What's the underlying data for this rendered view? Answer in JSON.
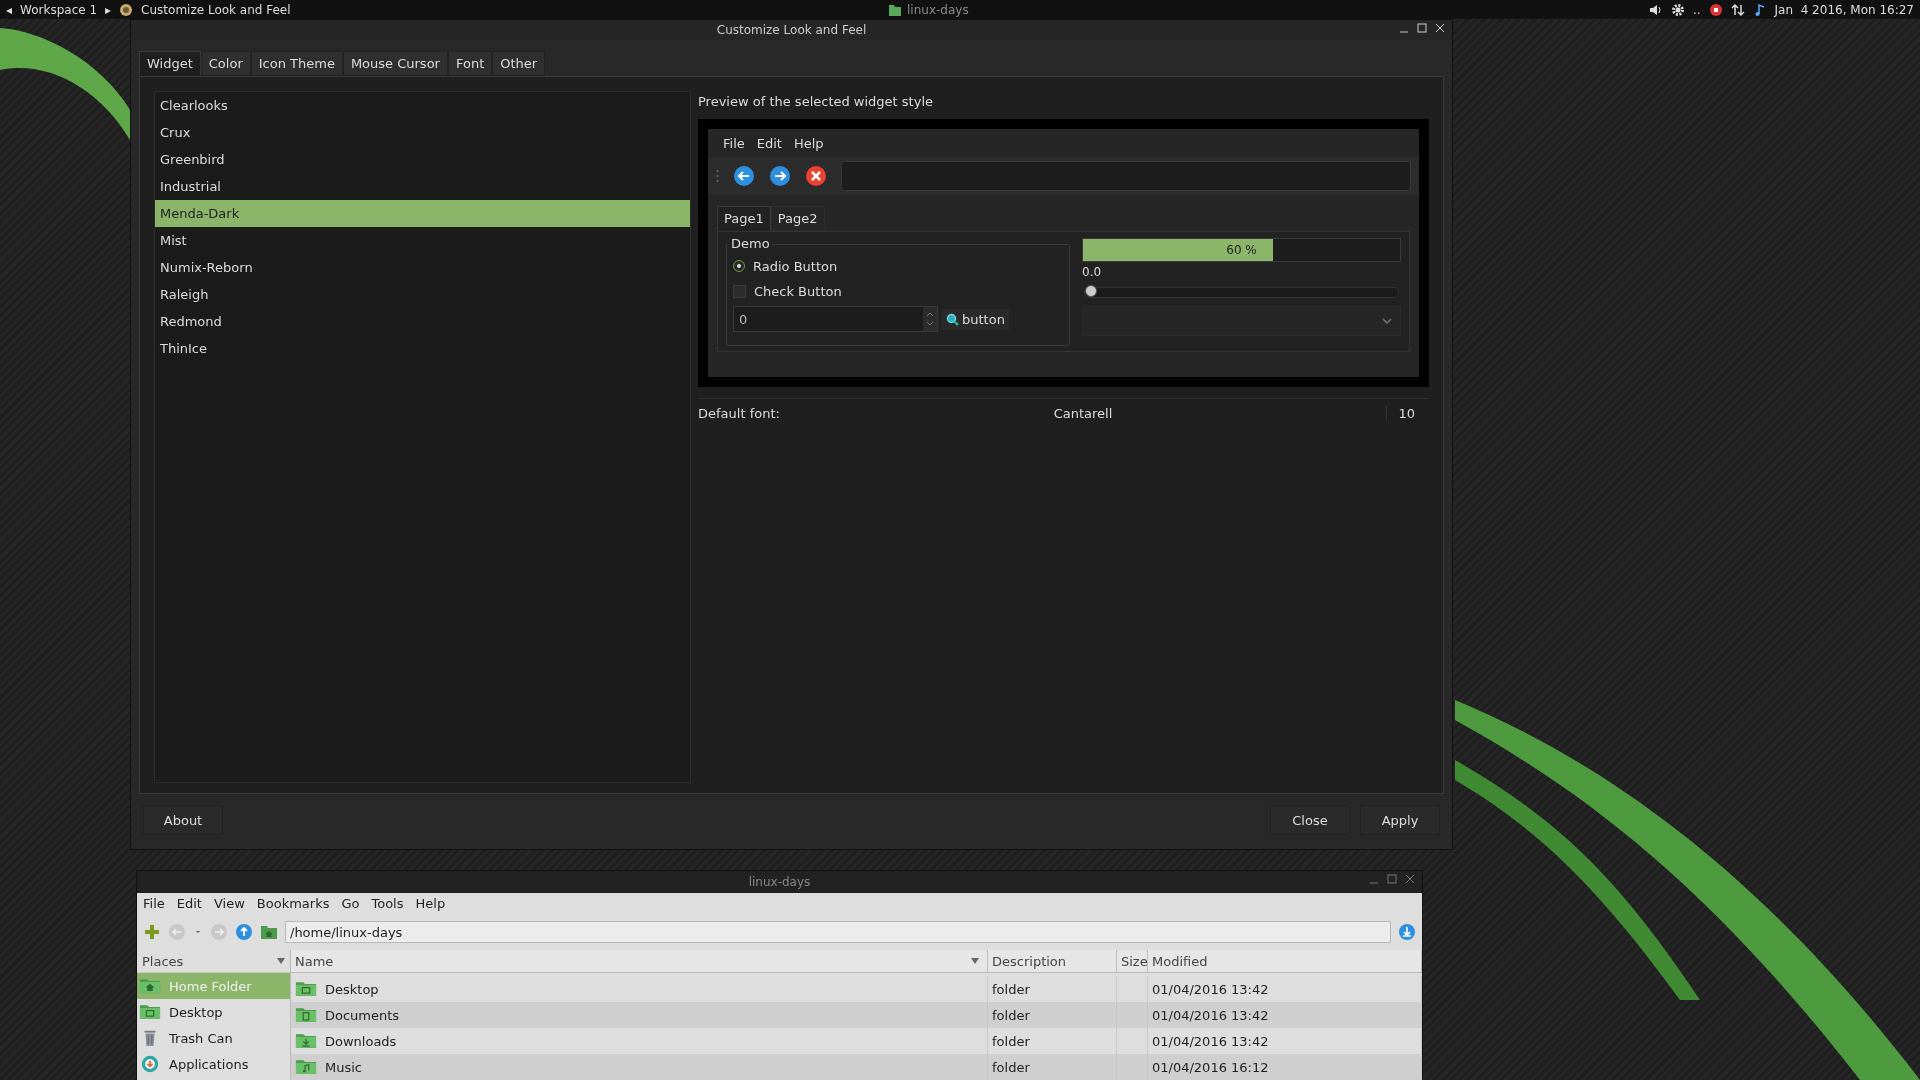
{
  "top_panel": {
    "prev_arrow": "◂",
    "workspace": "Workspace 1",
    "next_arrow": "▸",
    "active_window": "Customize Look and Feel",
    "task": "linux-days",
    "tray_dots": "..",
    "clock": "Jan  4 2016, Mon 16:27"
  },
  "dialog": {
    "title": "Customize Look and Feel",
    "tabs": [
      {
        "label": "Widget",
        "selected": true
      },
      {
        "label": "Color",
        "selected": false
      },
      {
        "label": "Icon Theme",
        "selected": false
      },
      {
        "label": "Mouse Cursor",
        "selected": false
      },
      {
        "label": "Font",
        "selected": false
      },
      {
        "label": "Other",
        "selected": false
      }
    ],
    "themes": [
      {
        "name": "Clearlooks",
        "selected": false
      },
      {
        "name": "Crux",
        "selected": false
      },
      {
        "name": "Greenbird",
        "selected": false
      },
      {
        "name": "Industrial",
        "selected": false
      },
      {
        "name": "Menda-Dark",
        "selected": true
      },
      {
        "name": "Mist",
        "selected": false
      },
      {
        "name": "Numix-Reborn",
        "selected": false
      },
      {
        "name": "Raleigh",
        "selected": false
      },
      {
        "name": "Redmond",
        "selected": false
      },
      {
        "name": "ThinIce",
        "selected": false
      }
    ],
    "preview": {
      "heading": "Preview of the selected widget style",
      "menu": [
        "File",
        "Edit",
        "Help"
      ],
      "tabs": [
        {
          "label": "Page1",
          "selected": true
        },
        {
          "label": "Page2",
          "selected": false
        }
      ],
      "frame_label": "Demo",
      "radio": {
        "label": "Radio Button",
        "checked": true
      },
      "check": {
        "label": "Check Button",
        "checked": false
      },
      "spin_value": "0",
      "button": "button",
      "progress": {
        "level": 0.6,
        "text": "60 %"
      },
      "scale_value": "0.0",
      "slider": {
        "level": 0
      }
    },
    "font": {
      "label": "Default font:",
      "family": "Cantarell",
      "size": "10"
    },
    "buttons_left": [
      "About"
    ],
    "buttons_right": [
      "Close",
      "Apply"
    ]
  },
  "file_manager": {
    "title": "linux-days",
    "menu": [
      "File",
      "Edit",
      "View",
      "Bookmarks",
      "Go",
      "Tools",
      "Help"
    ],
    "path": "/home/linux-days",
    "places_label": "Places",
    "places": [
      {
        "name": "Home Folder",
        "kind": "home",
        "selected": true
      },
      {
        "name": "Desktop",
        "kind": "desktop",
        "selected": false
      },
      {
        "name": "Trash Can",
        "kind": "trash",
        "selected": false
      },
      {
        "name": "Applications",
        "kind": "apps",
        "selected": false
      }
    ],
    "columns": [
      "Name",
      "Description",
      "Size",
      "Modified"
    ],
    "rows": [
      {
        "name": "Desktop",
        "kind": "desktop",
        "description": "folder",
        "modified": "01/04/2016 13:42"
      },
      {
        "name": "Documents",
        "kind": "documents",
        "description": "folder",
        "modified": "01/04/2016 13:42"
      },
      {
        "name": "Downloads",
        "kind": "downloads",
        "description": "folder",
        "modified": "01/04/2016 13:42"
      },
      {
        "name": "Music",
        "kind": "music",
        "description": "folder",
        "modified": "01/04/2016 16:12"
      }
    ]
  }
}
